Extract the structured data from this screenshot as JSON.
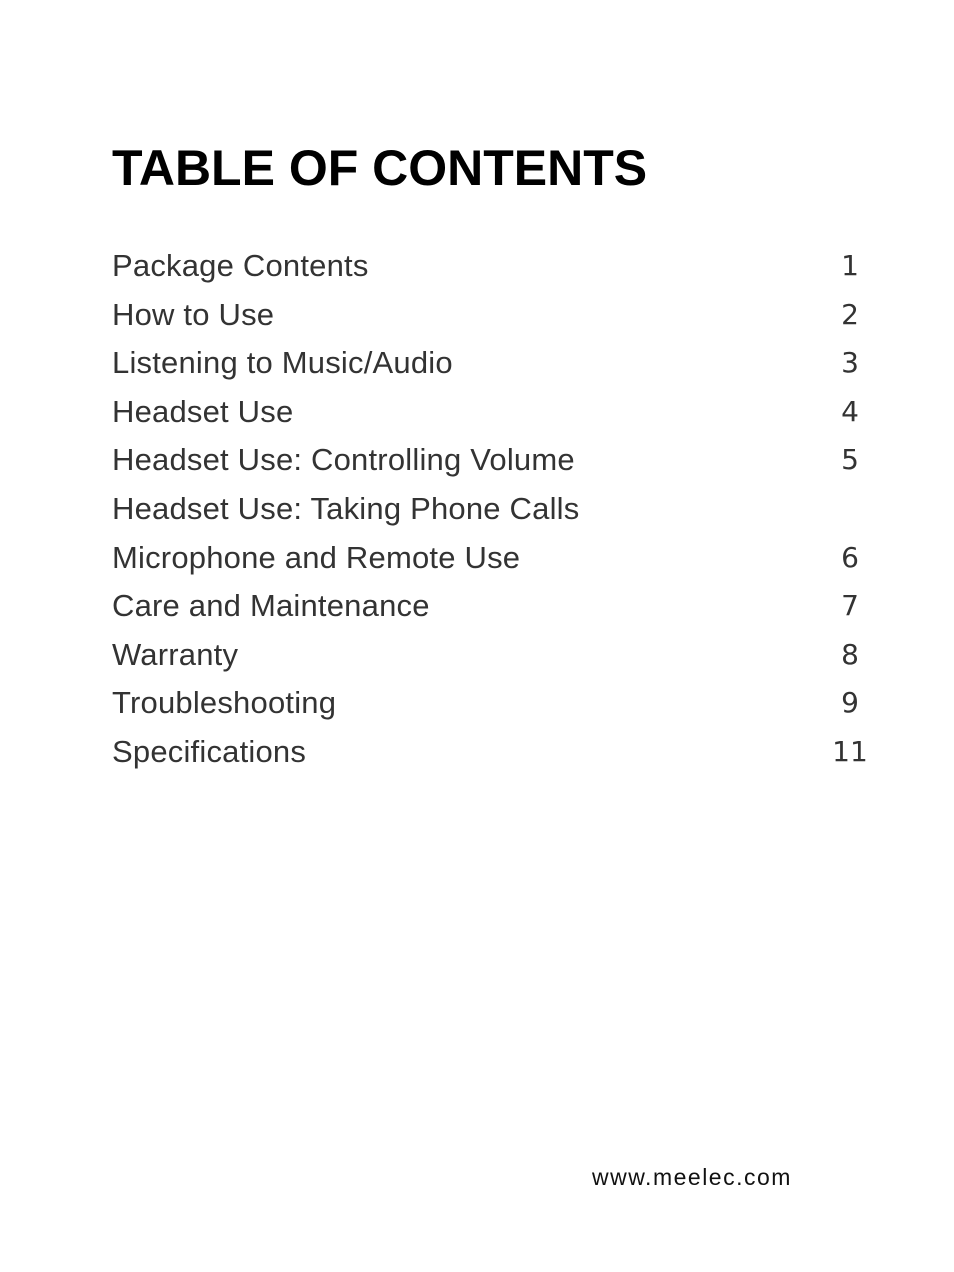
{
  "title": "TABLE OF CONTENTS",
  "toc": [
    {
      "label": "Package Contents",
      "page": "1"
    },
    {
      "label": "How to Use",
      "page": "2"
    },
    {
      "label": "Listening to Music/Audio",
      "page": "3"
    },
    {
      "label": "Headset Use",
      "page": "4"
    },
    {
      "label": "Headset Use: Controlling Volume",
      "page": "5"
    },
    {
      "label": "Headset Use: Taking Phone Calls",
      "page": ""
    },
    {
      "label": "Microphone and Remote Use",
      "page": "6"
    },
    {
      "label": "Care and Maintenance",
      "page": "7"
    },
    {
      "label": "Warranty",
      "page": "8"
    },
    {
      "label": "Troubleshooting",
      "page": "9"
    },
    {
      "label": "Specifications",
      "page": "11"
    }
  ],
  "footer": {
    "website": "www.meelec.com"
  }
}
